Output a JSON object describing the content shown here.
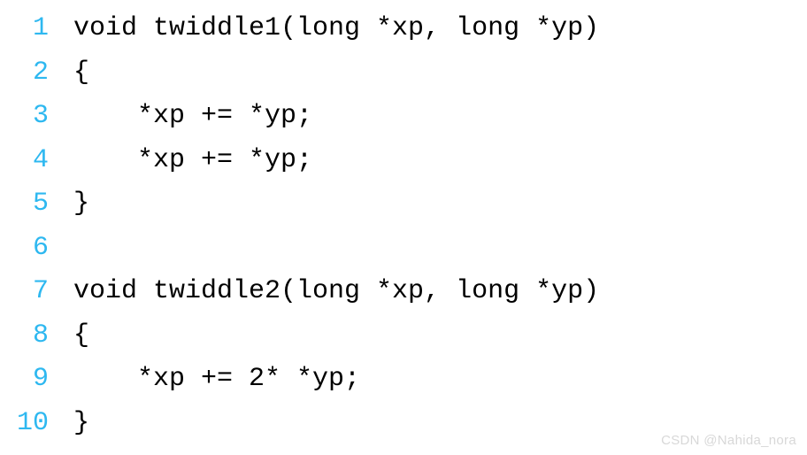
{
  "code": {
    "lines": [
      {
        "num": "1",
        "text": "void twiddle1(long *xp, long *yp)"
      },
      {
        "num": "2",
        "text": "{"
      },
      {
        "num": "3",
        "text": "    *xp += *yp;"
      },
      {
        "num": "4",
        "text": "    *xp += *yp;"
      },
      {
        "num": "5",
        "text": "}"
      },
      {
        "num": "6",
        "text": ""
      },
      {
        "num": "7",
        "text": "void twiddle2(long *xp, long *yp)"
      },
      {
        "num": "8",
        "text": "{"
      },
      {
        "num": "9",
        "text": "    *xp += 2* *yp;"
      },
      {
        "num": "10",
        "text": "}"
      }
    ]
  },
  "watermark": "CSDN @Nahida_nora"
}
